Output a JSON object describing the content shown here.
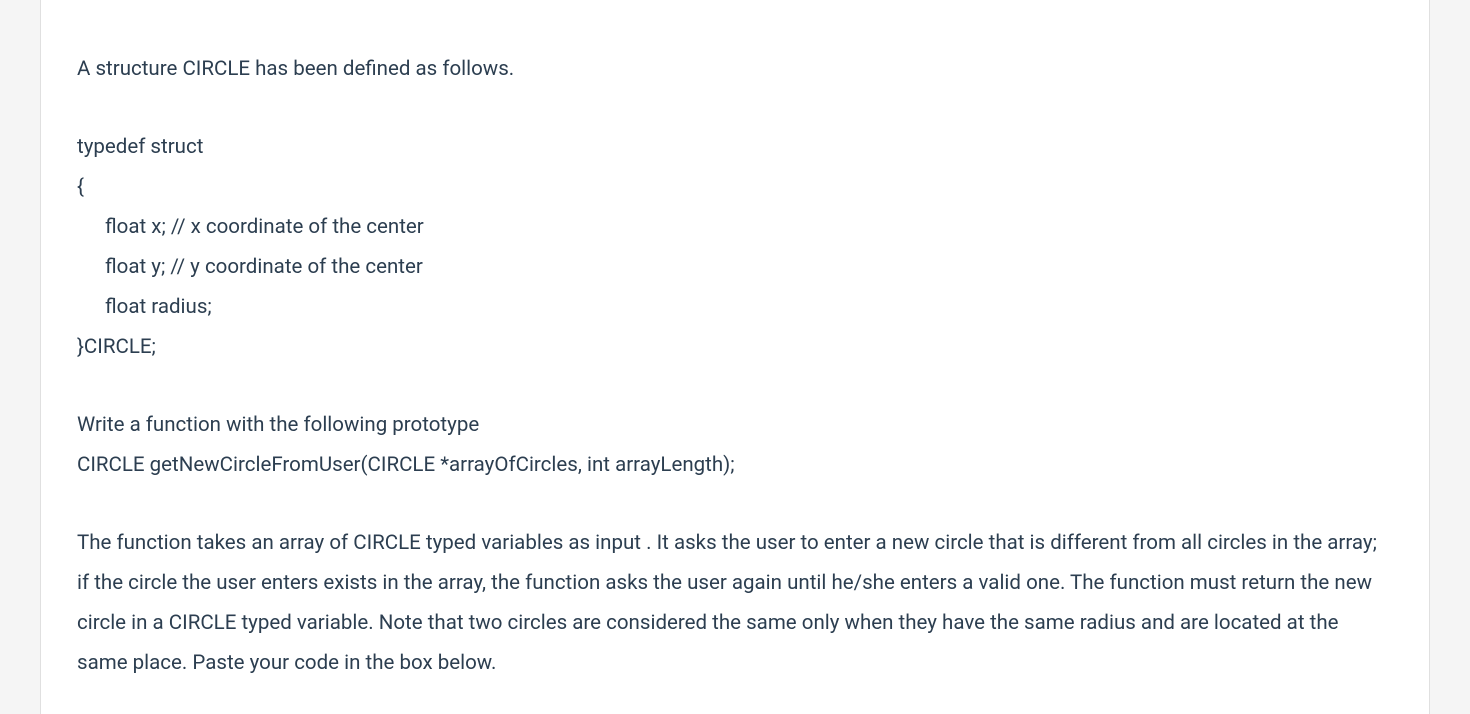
{
  "question": {
    "intro": "A structure CIRCLE has been defined as follows.",
    "code": {
      "line1": "typedef struct",
      "line2": "{",
      "line3": "float x; // x coordinate of the center",
      "line4": "float y; // y coordinate of the center",
      "line5": "float radius;",
      "line6": "}CIRCLE;"
    },
    "prototype_intro": "Write a function with the following prototype",
    "prototype": "CIRCLE getNewCircleFromUser(CIRCLE *arrayOfCircles, int arrayLength);",
    "description": "The function takes an array of CIRCLE typed variables as input . It asks the user to enter a new circle that is different from all circles in the array; if the circle the user enters exists in the array, the function asks the user again until he/she enters a valid one. The function must return the new circle in a CIRCLE typed variable. Note that two circles are  considered the same only when they have the same radius and are located at the same place. Paste your code in the box below."
  }
}
